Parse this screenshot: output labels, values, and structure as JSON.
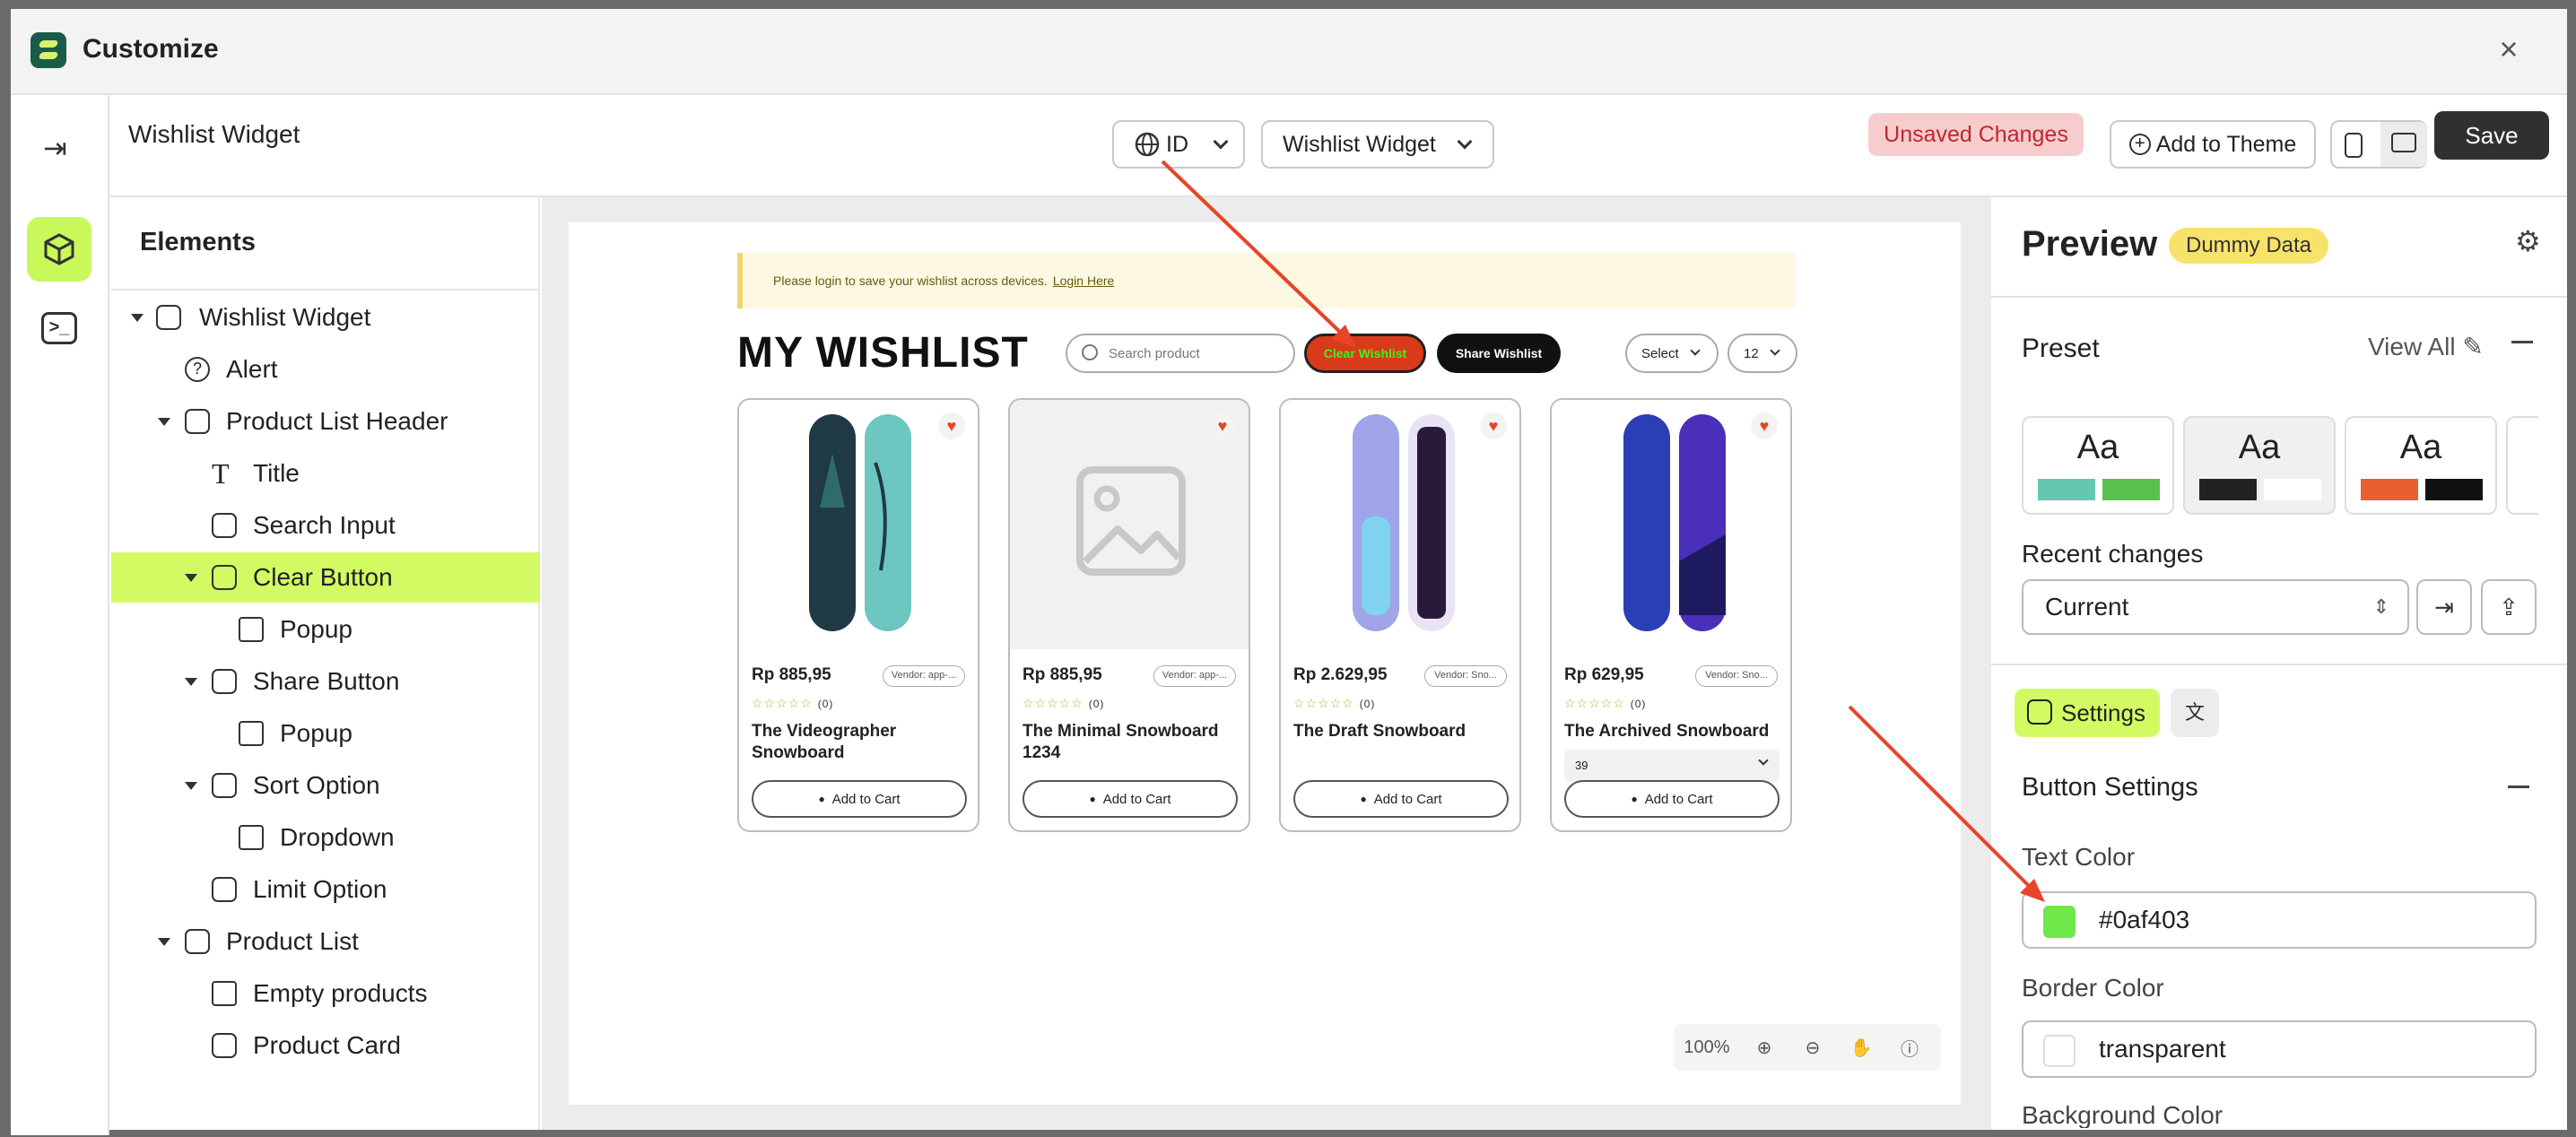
{
  "app": {
    "title": "Customize",
    "widget_name": "Wishlist Widget"
  },
  "toolbar": {
    "language": "ID",
    "widget_select": "Wishlist Widget",
    "unsaved": "Unsaved Changes",
    "add_to_theme": "Add to Theme",
    "save": "Save"
  },
  "elements": {
    "heading": "Elements",
    "nodes": [
      "Wishlist Widget",
      "Alert",
      "Product List Header",
      "Title",
      "Search Input",
      "Clear Button",
      "Popup",
      "Share Button",
      "Popup",
      "Sort Option",
      "Dropdown",
      "Limit Option",
      "Product List",
      "Empty products",
      "Product Card"
    ]
  },
  "canvas": {
    "alert_text": "Please login to save your wishlist across devices.",
    "alert_link": "Login Here",
    "title": "MY WISHLIST",
    "search_placeholder": "Search product",
    "clear_label": "Clear Wishlist",
    "share_label": "Share Wishlist",
    "sort_label": "Select",
    "limit_label": "12",
    "cards": [
      {
        "price": "Rp 885,95",
        "vendor": "Vendor: app-...",
        "reviews": "(0)",
        "name": "The Videographer Snowboard",
        "cart": "Add to Cart"
      },
      {
        "price": "Rp 885,95",
        "vendor": "Vendor: app-...",
        "reviews": "(0)",
        "name": "The Minimal Snowboard 1234",
        "cart": "Add to Cart"
      },
      {
        "price": "Rp 2.629,95",
        "vendor": "Vendor: Sno...",
        "reviews": "(0)",
        "name": "The Draft Snowboard",
        "cart": "Add to Cart"
      },
      {
        "price": "Rp 629,95",
        "vendor": "Vendor: Sno...",
        "reviews": "(0)",
        "name": "The Archived Snowboard",
        "variant": "39",
        "cart": "Add to Cart"
      }
    ],
    "zoom": "100%"
  },
  "panel": {
    "title": "Preview",
    "badge": "Dummy Data",
    "preset_label": "Preset",
    "view_all": "View All",
    "preset_sample": "Aa",
    "recent_label": "Recent changes",
    "recent_value": "Current",
    "settings_tab": "Settings",
    "section": "Button Settings",
    "text_color_label": "Text Color",
    "text_color_value": "#0af403",
    "border_color_label": "Border Color",
    "border_color_value": "transparent",
    "bg_color_label": "Background Color"
  },
  "colors": {
    "accent": "#d2fb63",
    "clear_btn_bg": "#d93a1a",
    "clear_btn_text": "#0af403",
    "annotation_arrow": "#e8442a"
  }
}
